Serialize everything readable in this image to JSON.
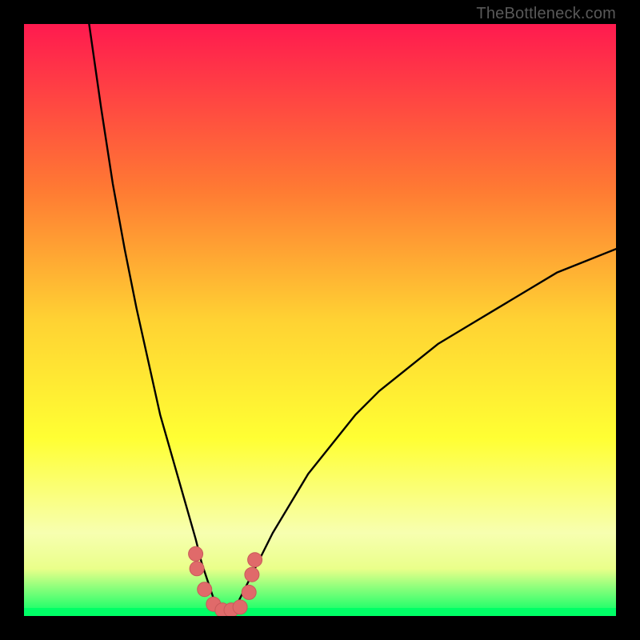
{
  "watermark": "TheBottleneck.com",
  "colors": {
    "bg": "#000000",
    "gradient_top": "#ff1a4f",
    "gradient_mid1": "#ff7a33",
    "gradient_mid2": "#ffd233",
    "gradient_mid3": "#ffff33",
    "gradient_low": "#f7ffb0",
    "gradient_band": "#eaff8a",
    "gradient_bottom": "#00ff66",
    "curve": "#000000",
    "marker_fill": "#e06a6a",
    "marker_stroke": "#c85a5a"
  },
  "chart_data": {
    "type": "line",
    "title": "",
    "xlabel": "",
    "ylabel": "",
    "xlim": [
      0,
      100
    ],
    "ylim": [
      0,
      100
    ],
    "grid": false,
    "legend": false,
    "series": [
      {
        "name": "bottleneck-curve",
        "description": "V-shaped bottleneck curve; minimum near x≈34 at y≈0; rises steeply to ~100 at x≈11 (left) and to ~62 at x=100 (right).",
        "x": [
          11,
          13,
          15,
          17,
          19,
          21,
          23,
          25,
          27,
          29,
          30,
          31,
          32,
          33,
          34,
          35,
          36,
          37,
          38,
          40,
          42,
          45,
          48,
          52,
          56,
          60,
          65,
          70,
          75,
          80,
          85,
          90,
          95,
          100
        ],
        "y": [
          100,
          86,
          73,
          62,
          52,
          43,
          34,
          27,
          20,
          13,
          9,
          6,
          3,
          1,
          0,
          1,
          2,
          4,
          6,
          10,
          14,
          19,
          24,
          29,
          34,
          38,
          42,
          46,
          49,
          52,
          55,
          58,
          60,
          62
        ]
      }
    ],
    "markers": {
      "description": "Cluster of rounded markers around the curve minimum (the 'sweet spot').",
      "points": [
        {
          "x": 29.0,
          "y": 10.5
        },
        {
          "x": 29.2,
          "y": 8.0
        },
        {
          "x": 30.5,
          "y": 4.5
        },
        {
          "x": 32.0,
          "y": 2.0
        },
        {
          "x": 33.5,
          "y": 1.0
        },
        {
          "x": 35.0,
          "y": 1.0
        },
        {
          "x": 36.5,
          "y": 1.5
        },
        {
          "x": 38.0,
          "y": 4.0
        },
        {
          "x": 38.5,
          "y": 7.0
        },
        {
          "x": 39.0,
          "y": 9.5
        }
      ]
    }
  }
}
